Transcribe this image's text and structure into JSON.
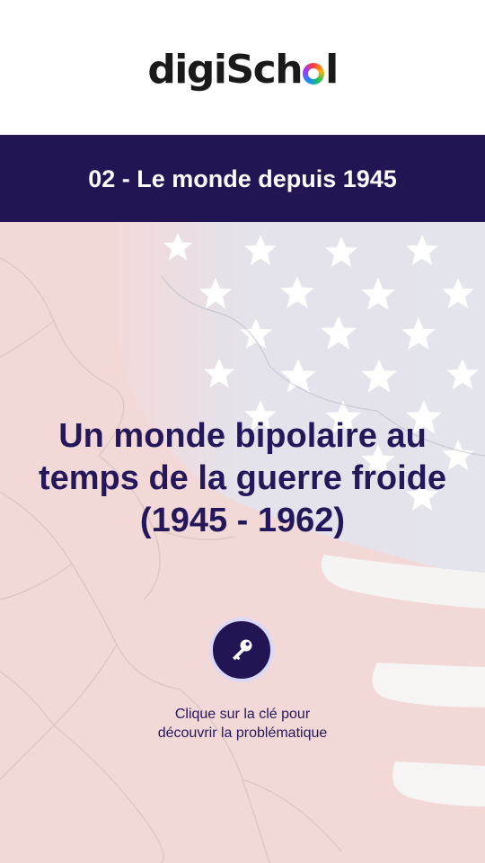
{
  "header": {
    "logo_text": "digiSchool",
    "logo_prefix": "digiSch",
    "logo_suffix": "l"
  },
  "banner": {
    "title": "02 - Le monde depuis 1945"
  },
  "hero": {
    "title_line1": "Un monde bipolaire au",
    "title_line2": "temps de la guerre froide",
    "title_line3": "(1945 - 1962)",
    "key_icon": "key-icon",
    "hint_line1": "Clique sur la clé pour",
    "hint_line2": "découvrir la problématique"
  },
  "colors": {
    "navy": "#231553",
    "title_purple": "#25185a",
    "flag_red": "#f1d0d0",
    "flag_blue": "#e1e1ea",
    "key_ring": "#dcd9f7"
  }
}
